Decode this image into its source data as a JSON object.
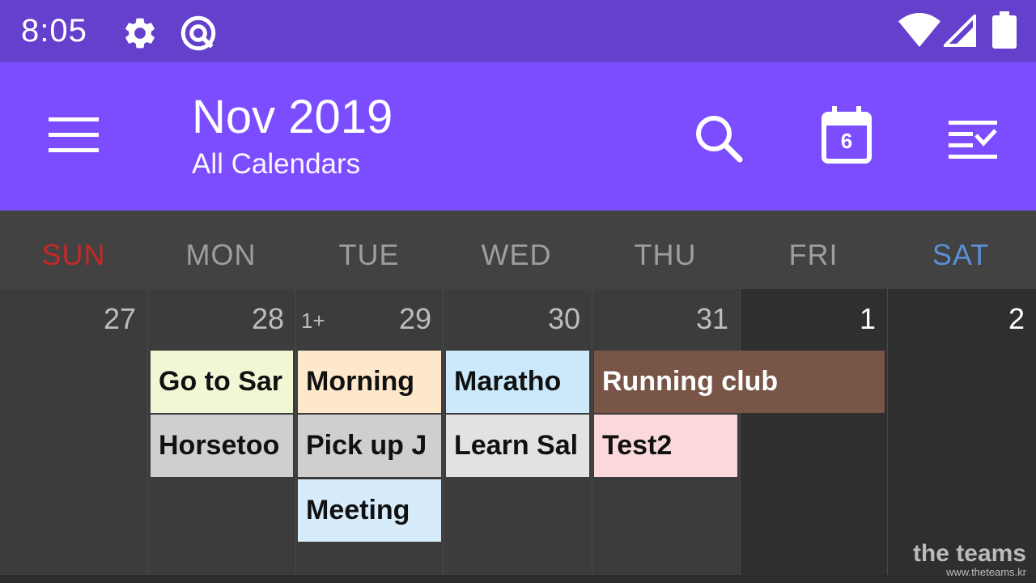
{
  "status_bar": {
    "time": "8:05",
    "icons": [
      "gear-icon",
      "vpn-icon",
      "wifi-icon",
      "signal-icon",
      "battery-icon"
    ]
  },
  "app_bar": {
    "title": "Nov 2019",
    "subtitle": "All Calendars",
    "today_number": "6",
    "color": "#7c4dff"
  },
  "weekdays": [
    {
      "label": "SUN",
      "color": "#c62828"
    },
    {
      "label": "MON",
      "color": "#9e9e9e"
    },
    {
      "label": "TUE",
      "color": "#9e9e9e"
    },
    {
      "label": "WED",
      "color": "#9e9e9e"
    },
    {
      "label": "THU",
      "color": "#9e9e9e"
    },
    {
      "label": "FRI",
      "color": "#9e9e9e"
    },
    {
      "label": "SAT",
      "color": "#5b8fd6"
    }
  ],
  "days": [
    {
      "num": "27",
      "more": ""
    },
    {
      "num": "28",
      "more": ""
    },
    {
      "num": "29",
      "more": "1+"
    },
    {
      "num": "30",
      "more": ""
    },
    {
      "num": "31",
      "more": ""
    },
    {
      "num": "1",
      "more": ""
    },
    {
      "num": "2",
      "more": ""
    }
  ],
  "events": [
    {
      "label": "Go to Sar",
      "color": "#f0f7d4"
    },
    {
      "label": "Horsetoo",
      "color": "#cfcfcf"
    },
    {
      "label": "Morning",
      "color": "#fde8cc"
    },
    {
      "label": "Pick up J",
      "color": "#cfcfcf"
    },
    {
      "label": "Meeting",
      "color": "#d6ecfb"
    },
    {
      "label": "Maratho",
      "color": "#cbe9fb"
    },
    {
      "label": "Learn Sal",
      "color": "#e2e2e2"
    },
    {
      "label": "Running club",
      "color": "#795548"
    },
    {
      "label": "Test2",
      "color": "#fbd9da"
    }
  ],
  "watermark": {
    "main": "the teams",
    "sub": "www.theteams.kr"
  }
}
